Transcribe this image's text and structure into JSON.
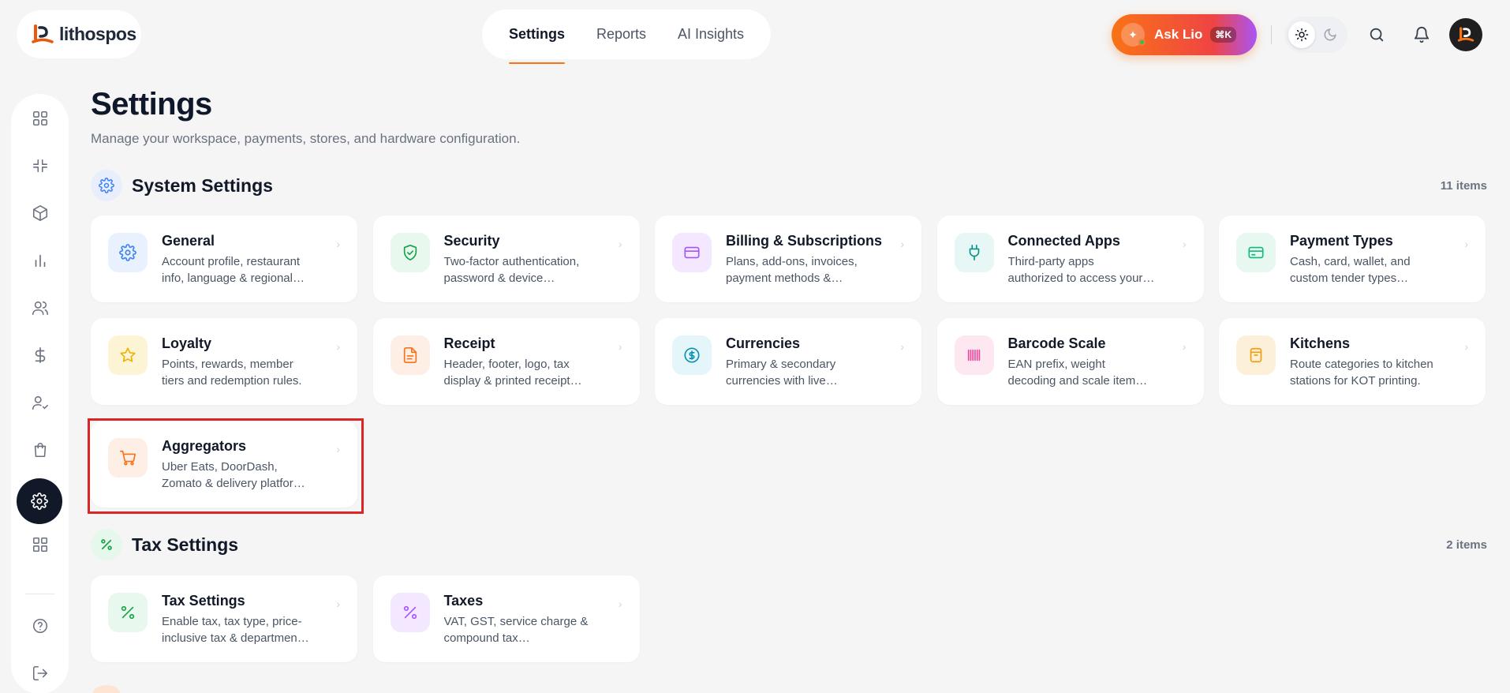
{
  "brand": {
    "name": "lithospos"
  },
  "top_tabs": [
    {
      "label": "Settings",
      "active": true
    },
    {
      "label": "Reports",
      "active": false
    },
    {
      "label": "AI Insights",
      "active": false
    }
  ],
  "ask": {
    "label": "Ask Lio",
    "shortcut": "⌘K"
  },
  "page": {
    "title": "Settings",
    "subtitle": "Manage your workspace, payments, stores, and hardware configuration."
  },
  "sections": [
    {
      "title": "System Settings",
      "count": "11 items",
      "cards": [
        {
          "title": "General",
          "desc1": "Account profile, restaurant",
          "desc2": "info, language & regional…",
          "icon": "gear-icon",
          "color": "#3b82f6",
          "bg": "#eaf1fe"
        },
        {
          "title": "Security",
          "desc1": "Two-factor authentication,",
          "desc2": "password & device…",
          "icon": "shield-icon",
          "color": "#16a34a",
          "bg": "#e8f8ee"
        },
        {
          "title": "Billing & Subscriptions",
          "desc1": "Plans, add-ons, invoices,",
          "desc2": "payment methods &…",
          "icon": "credit-card-icon",
          "color": "#a855f7",
          "bg": "#f3e8ff"
        },
        {
          "title": "Connected Apps",
          "desc1": "Third-party apps",
          "desc2": "authorized to access your…",
          "icon": "plug-icon",
          "color": "#0d9488",
          "bg": "#e6f7f5"
        },
        {
          "title": "Payment Types",
          "desc1": "Cash, card, wallet, and",
          "desc2": "custom tender types…",
          "icon": "wallet-card-icon",
          "color": "#10b981",
          "bg": "#e7f8f0"
        },
        {
          "title": "Loyalty",
          "desc1": "Points, rewards, member",
          "desc2": "tiers and redemption rules.",
          "icon": "star-icon",
          "color": "#eab308",
          "bg": "#fdf4d6"
        },
        {
          "title": "Receipt",
          "desc1": "Header, footer, logo, tax",
          "desc2": "display & printed receipt…",
          "icon": "receipt-icon",
          "color": "#f97316",
          "bg": "#fdeee6"
        },
        {
          "title": "Currencies",
          "desc1": "Primary & secondary",
          "desc2": "currencies with live…",
          "icon": "dollar-circle-icon",
          "color": "#0891b2",
          "bg": "#e4f6f9"
        },
        {
          "title": "Barcode Scale",
          "desc1": "EAN prefix, weight",
          "desc2": "decoding and scale item…",
          "icon": "barcode-icon",
          "color": "#ec4899",
          "bg": "#fde8f2"
        },
        {
          "title": "Kitchens",
          "desc1": "Route categories to kitchen",
          "desc2": "stations for KOT printing.",
          "icon": "archive-icon",
          "color": "#f59e0b",
          "bg": "#fdf0d8"
        },
        {
          "title": "Aggregators",
          "desc1": "Uber Eats, DoorDash,",
          "desc2": "Zomato & delivery platfor…",
          "icon": "cart-icon",
          "color": "#f97316",
          "bg": "#fdeee6"
        }
      ]
    },
    {
      "title": "Tax Settings",
      "count": "2 items",
      "cards": [
        {
          "title": "Tax Settings",
          "desc1": "Enable tax, tax type, price-",
          "desc2": "inclusive tax & departmen…",
          "icon": "percent-icon",
          "color": "#16a34a",
          "bg": "#e8f8ee"
        },
        {
          "title": "Taxes",
          "desc1": "VAT, GST, service charge &",
          "desc2": "compound tax…",
          "icon": "percent-icon",
          "color": "#a855f7",
          "bg": "#f3e8ff"
        }
      ]
    }
  ]
}
